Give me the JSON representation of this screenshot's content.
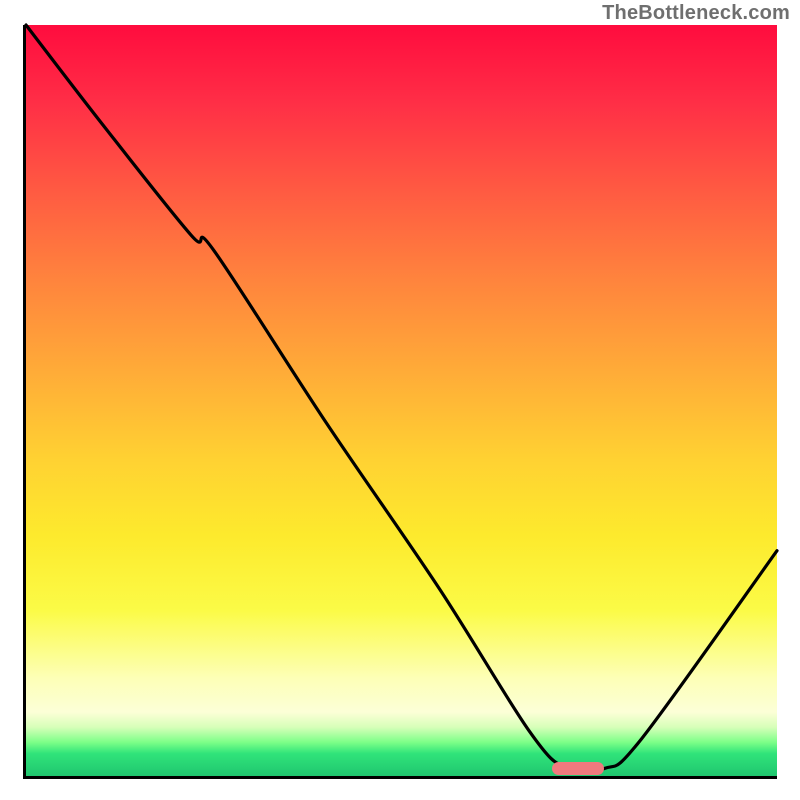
{
  "watermark": "TheBottleneck.com",
  "colors": {
    "axis": "#000000",
    "curve": "#000000",
    "marker": "#f07a7e",
    "gradient_top": "#ff0c3e",
    "gradient_mid1": "#ffab38",
    "gradient_mid2": "#fdea2d",
    "gradient_bottom": "#20c66f"
  },
  "chart_data": {
    "type": "line",
    "title": "",
    "xlabel": "",
    "ylabel": "",
    "xlim": [
      0,
      100
    ],
    "ylim": [
      0,
      100
    ],
    "grid": false,
    "background": "heat-gradient-red-to-green",
    "series": [
      {
        "name": "bottleneck-curve",
        "x": [
          0,
          10,
          22,
          25,
          40,
          55,
          67,
          72,
          77,
          82,
          100
        ],
        "values": [
          100,
          87,
          72,
          70,
          47,
          25,
          6,
          1,
          1,
          5,
          30
        ]
      }
    ],
    "marker": {
      "name": "optimal-range",
      "x_start": 70,
      "x_end": 77,
      "y": 1
    },
    "annotations": []
  }
}
